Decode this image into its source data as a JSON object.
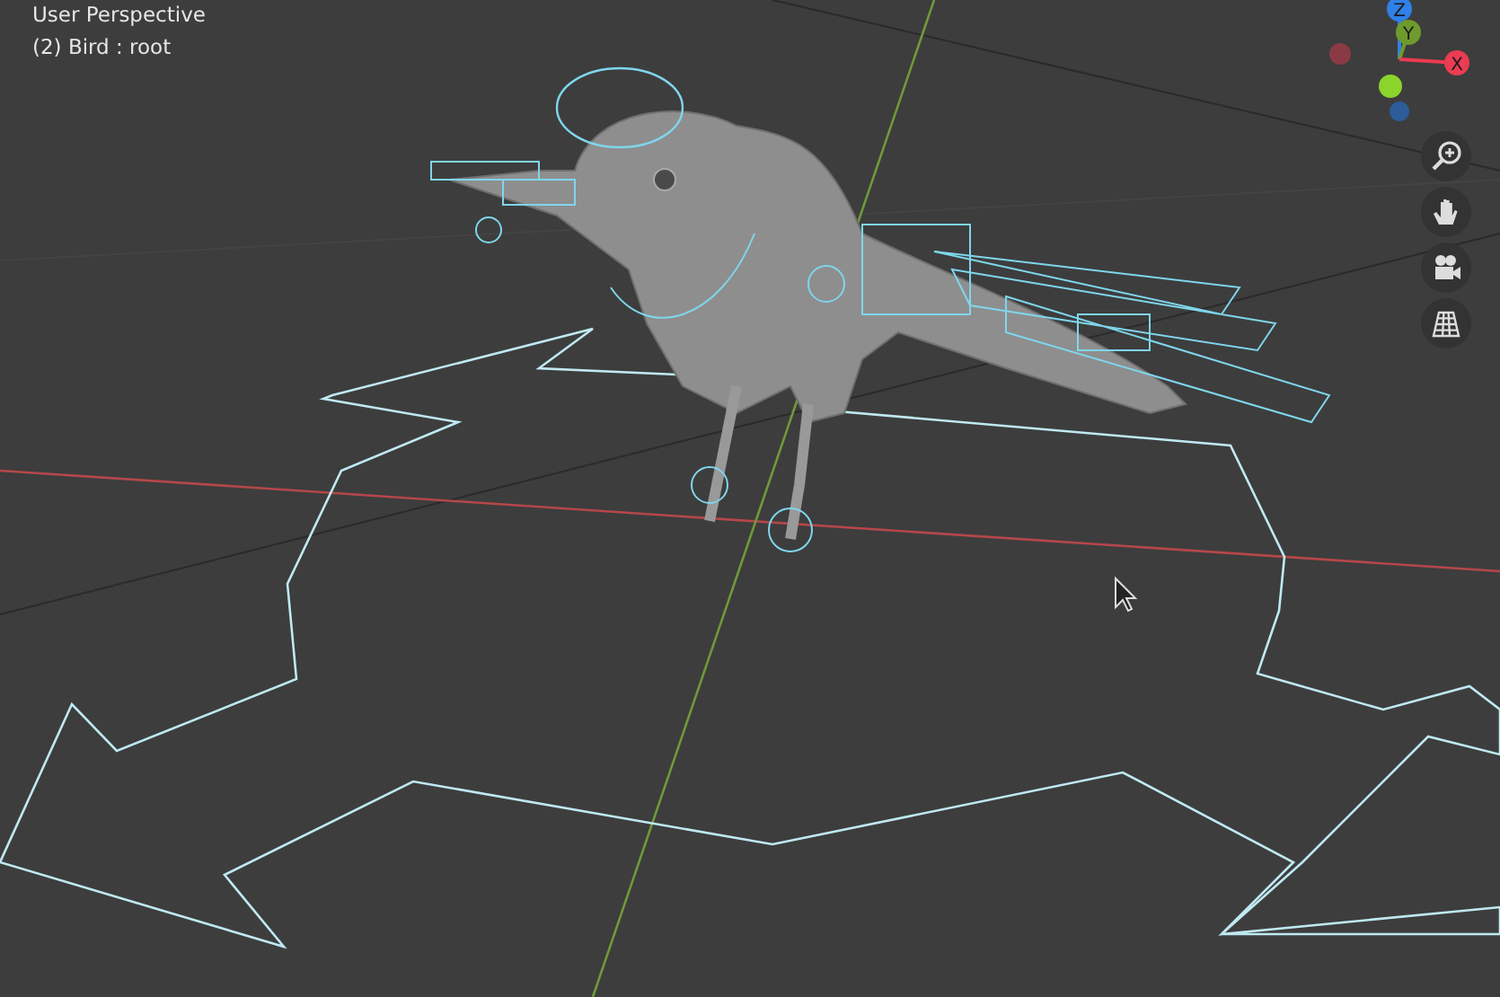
{
  "viewport": {
    "title": "User Perspective",
    "object": "(2) Bird : root"
  },
  "gizmo": {
    "axes": [
      {
        "label": "Z",
        "color": "#2f80e8"
      },
      {
        "label": "Y",
        "color": "#6f9a2c"
      },
      {
        "label": "X",
        "color": "#ea3c52"
      }
    ]
  },
  "tools": [
    {
      "kind": "zoom"
    },
    {
      "kind": "pan"
    },
    {
      "kind": "camera"
    },
    {
      "kind": "grid"
    }
  ]
}
